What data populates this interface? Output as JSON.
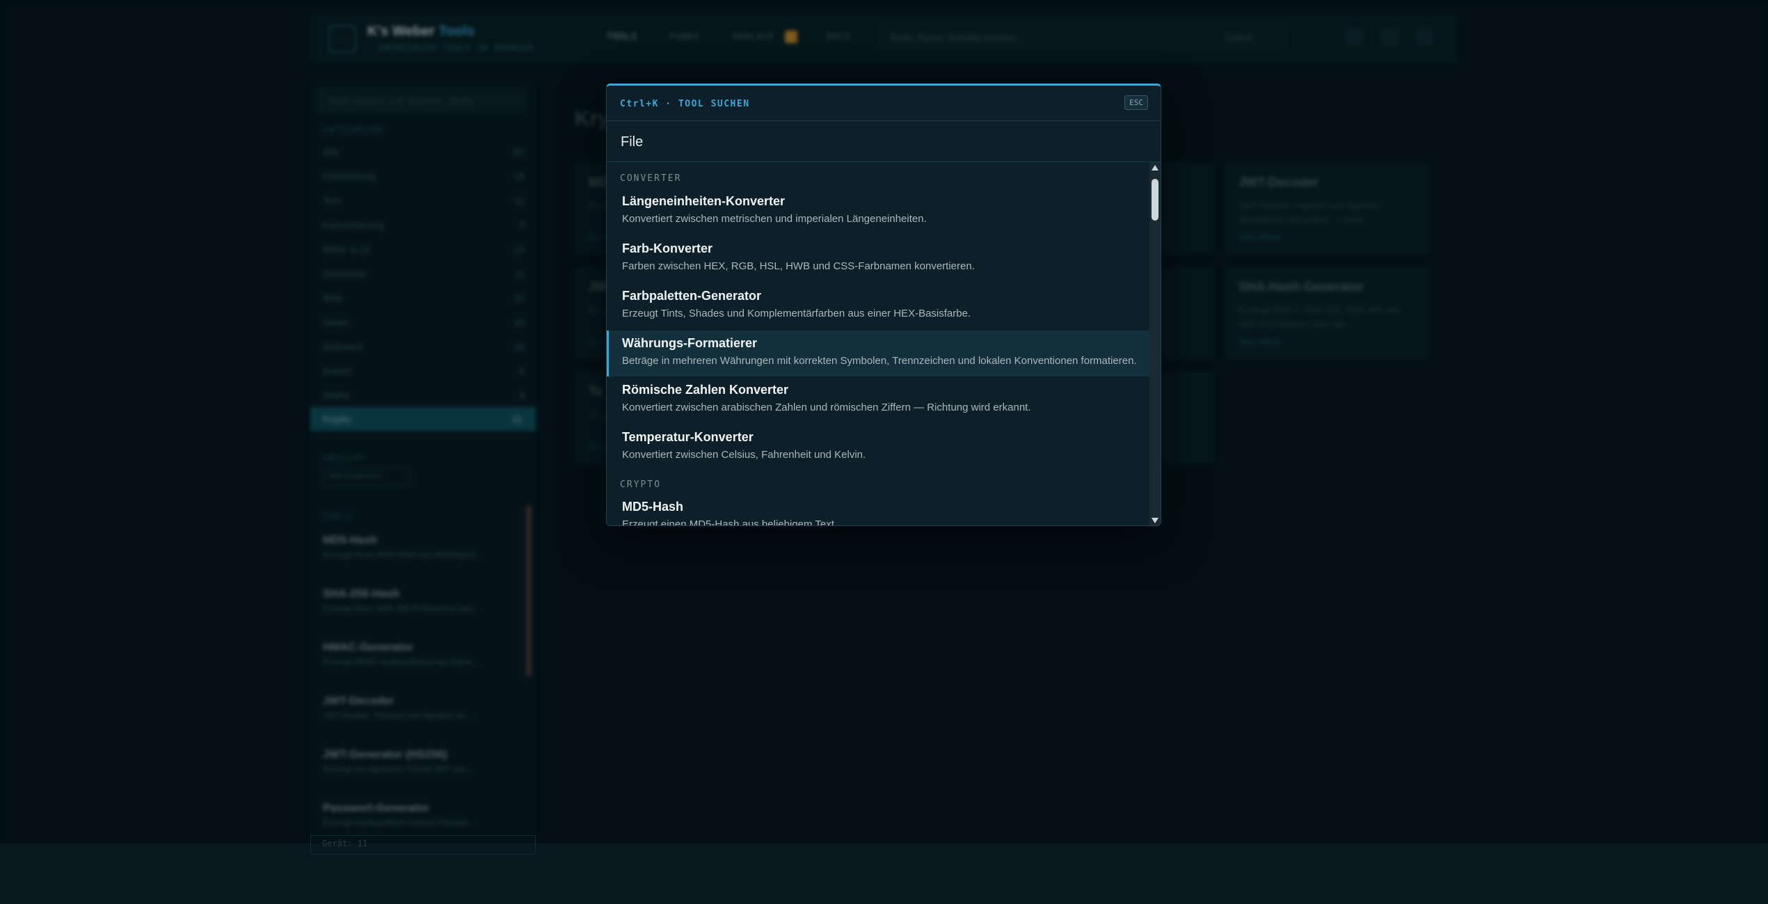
{
  "app": {
    "brand_name": "K's Weber",
    "brand_accent": "Tools",
    "brand_sub": "ENTWICKLER-TOOLS IM BROWSER",
    "nav": [
      "TOOLS",
      "FUNKS",
      "VERLAUF",
      "DOCS"
    ],
    "search_placeholder": "Tools, Flows, Befehle suchen...",
    "search_hint": "Ctrl+K"
  },
  "sidebar": {
    "search_placeholder": "Tools suchen, z.B. Base64, JSON",
    "categories_header": "KATEGORIEN",
    "categories": [
      {
        "label": "Alle",
        "count": "82"
      },
      {
        "label": "Entwicklung",
        "count": "14"
      },
      {
        "label": "Text",
        "count": "12"
      },
      {
        "label": "Konvertierung",
        "count": "9"
      },
      {
        "label": "Bilder & UI",
        "count": "10"
      },
      {
        "label": "Generator",
        "count": "11"
      },
      {
        "label": "Web",
        "count": "10"
      },
      {
        "label": "Daten",
        "count": "10"
      },
      {
        "label": "Netzwerk",
        "count": "10"
      },
      {
        "label": "Datum",
        "count": "6"
      },
      {
        "label": "Mathe",
        "count": "8"
      }
    ],
    "active_category": {
      "label": "Krypto",
      "count": "11"
    },
    "filter_header": "ANSICHT",
    "filter_chip": "Alle Zusammen",
    "tools_header": "TOOLS",
    "tools": [
      {
        "title": "MD5-Hash",
        "desc": "Erzeugt einen MD5-Hash aus beliebigem..."
      },
      {
        "title": "SHA-256-Hash",
        "desc": "Erzeugt einen SHA-256-Prüfsumme aus..."
      },
      {
        "title": "HMAC-Generator",
        "desc": "Erzeugt HMAC-Authentifizierungs-Signa..."
      },
      {
        "title": "JWT-Decoder",
        "desc": "JWT-Header, Payload und Signatur de..."
      },
      {
        "title": "JWT-Generator (HS256)",
        "desc": "Erzeugt ein signiertes HS256-JWT aus..."
      },
      {
        "title": "Passwort-Generator",
        "desc": "Erzeugt kryptografisch sichere Passwö..."
      }
    ],
    "footer": "Gerät: 11"
  },
  "main": {
    "page_title": "Kry",
    "cards": [
      {
        "title": "MD",
        "desc": "Er...",
        "link": "Zu"
      },
      {
        "title": "JWT-Decoder",
        "desc": "JWT-Header, Payload und Signatur dekodieren und prüfen — ohne...",
        "link": "Jetzt öffnen"
      },
      {
        "title": "JW",
        "desc": "Er...",
        "link": "Zu"
      },
      {
        "title": "SHA-Hash-Generator",
        "desc": "Erzeugt SHA-1, SHA-256, SHA-384 und SHA-512-Hashes über alle...",
        "link": "Jetzt öffnen"
      },
      {
        "title": "Te",
        "desc": "Te...",
        "link": "Zu"
      }
    ]
  },
  "palette": {
    "title": "Ctrl+K · TOOL SUCHEN",
    "esc": "ESC",
    "query": "File",
    "groups": [
      {
        "name": "CONVERTER",
        "items": [
          {
            "title": "Längeneinheiten-Konverter",
            "desc": "Konvertiert zwischen metrischen und imperialen Längeneinheiten."
          },
          {
            "title": "Farb-Konverter",
            "desc": "Farben zwischen HEX, RGB, HSL, HWB und CSS-Farbnamen konvertieren."
          },
          {
            "title": "Farbpaletten-Generator",
            "desc": "Erzeugt Tints, Shades und Komplementärfarben aus einer HEX-Basisfarbe."
          },
          {
            "title": "Währungs-Formatierer",
            "desc": "Beträge in mehreren Währungen mit korrekten Symbolen, Trennzeichen und lokalen Konventionen formatieren.",
            "selected": true
          },
          {
            "title": "Römische Zahlen Konverter",
            "desc": "Konvertiert zwischen arabischen Zahlen und römischen Ziffern — Richtung wird erkannt."
          },
          {
            "title": "Temperatur-Konverter",
            "desc": "Konvertiert zwischen Celsius, Fahrenheit und Kelvin."
          }
        ]
      },
      {
        "name": "CRYPTO",
        "items": [
          {
            "title": "MD5-Hash",
            "desc": "Erzeugt einen MD5-Hash aus beliebigem Text."
          }
        ]
      }
    ]
  },
  "colors": {
    "accent": "#3ba6d8",
    "modal_bg": "#0d1f28",
    "selected_bg": "#14303c",
    "page_bg": "#04141c"
  }
}
